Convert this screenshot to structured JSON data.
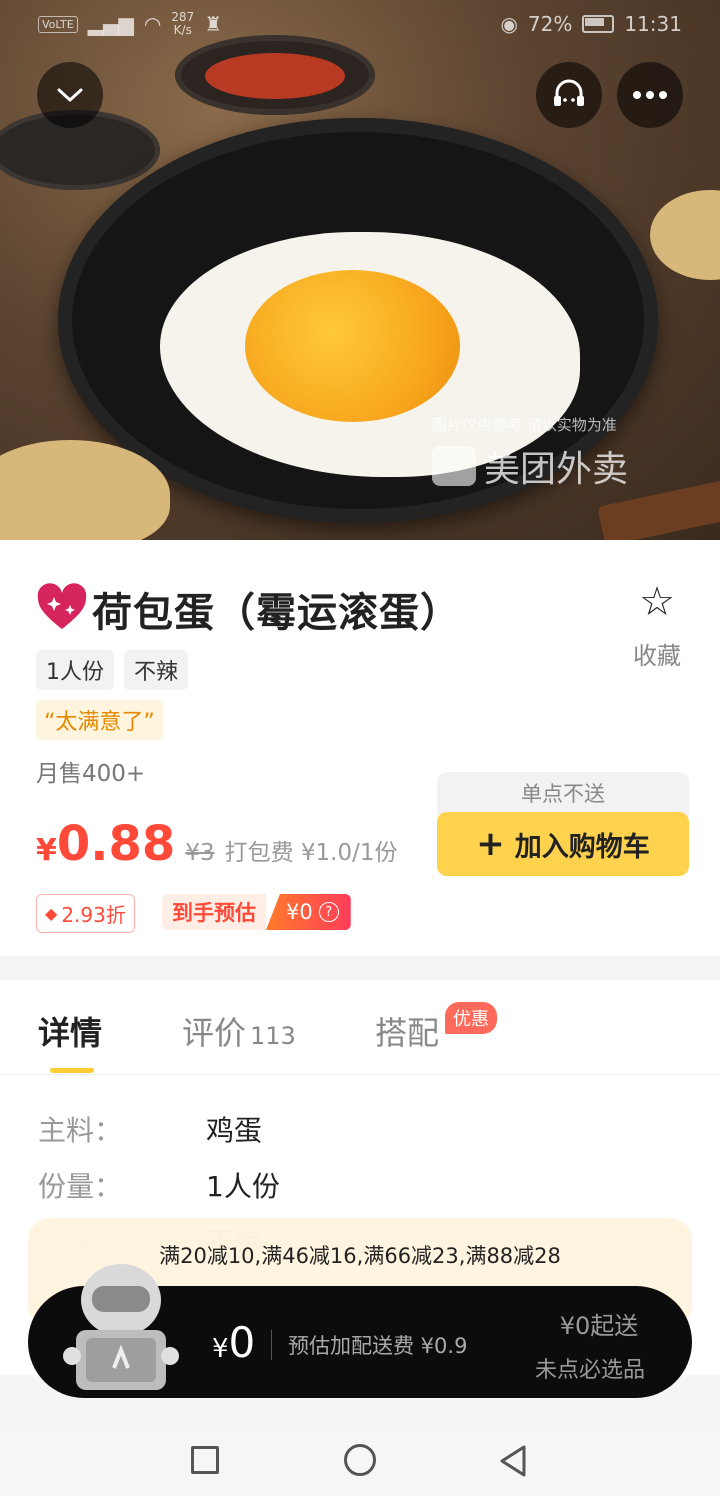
{
  "status_bar": {
    "volte": "VoLTE",
    "net_speed_value": "287",
    "net_speed_unit": "K/s",
    "battery": "72%",
    "time": "11:31"
  },
  "hero": {
    "watermark_note": "图片仅供参考 请以实物为准",
    "watermark_brand": "美团外卖"
  },
  "product": {
    "title": "荷包蛋（霉运滚蛋）",
    "tags": [
      "1人份",
      "不辣"
    ],
    "praise": "“太满意了”",
    "monthly_sales": "月售400+",
    "price_currency": "¥",
    "price": "0.88",
    "original_price": "¥3",
    "packing_fee": "打包费 ¥1.0/1份",
    "discount": "2.93折",
    "estimate_label": "到手预估",
    "estimate_value": "¥0",
    "favorite_label": "收藏",
    "single_note": "单点不送",
    "add_to_cart": "加入购物车"
  },
  "tabs": {
    "details": "详情",
    "reviews": "评价",
    "reviews_count": "113",
    "combo": "搭配",
    "combo_badge": "优惠"
  },
  "details": {
    "rows": [
      {
        "key": "主料：",
        "value": "鸡蛋"
      },
      {
        "key": "份量：",
        "value": "1人份"
      },
      {
        "key": "口味：",
        "value": "不辣"
      }
    ]
  },
  "cart": {
    "promo": "满20减10,满46减16,满66减23,满88减28",
    "currency": "¥",
    "amount": "0",
    "delivery_estimate": "预估加配送费 ¥0.9",
    "min_order": "¥0起送",
    "required_note": "未点必选品"
  },
  "colors": {
    "price_red": "#ff4a3a",
    "brand_yellow": "#ffd24d",
    "tab_indicator": "#ffcc33"
  }
}
